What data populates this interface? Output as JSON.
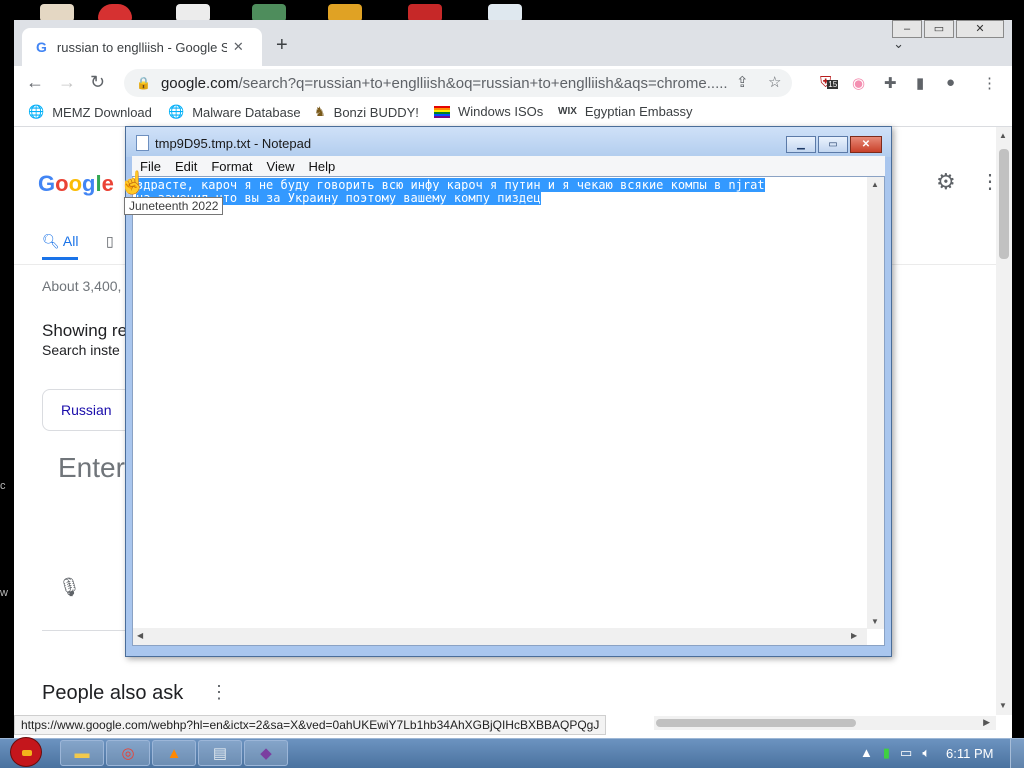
{
  "chrome": {
    "tab_title": "russian to englliish - Google Se",
    "tab_favicon": "G",
    "new_tab": "+",
    "url_host": "google.com",
    "url_path": "/search?q=russian+to+englliish&oq=russian+to+englliish&aqs=chrome.....",
    "extension_badge": "15",
    "bookmarks": [
      {
        "label": "MEMZ Download",
        "icon": "globe-icon"
      },
      {
        "label": "Malware Database",
        "icon": "globe-icon"
      },
      {
        "label": "Bonzi BUDDY!",
        "icon": "gorilla-icon"
      },
      {
        "label": "Windows ISOs",
        "icon": "rainbow-flag-icon"
      },
      {
        "label": "Egyptian Embassy",
        "icon": "wix-icon"
      }
    ],
    "status_url": "https://www.google.com/webhp?hl=en&ictx=2&sa=X&ved=0ahUKEwiY7Lb1hb34AhXGBjQIHcBXBBAQPQgJ"
  },
  "google": {
    "tab_all": "All",
    "result_stats": "About 3,400,",
    "showing": "Showing re",
    "search_instead": "Search inste",
    "translate_lang": "Russian",
    "translate_placeholder": "Enter",
    "people_also_ask": "People also ask",
    "logo_letters": [
      "G",
      "o",
      "o",
      "g",
      "l",
      "e"
    ],
    "logo_colors": [
      "#4285f4",
      "#ea4335",
      "#fbbc05",
      "#4285f4",
      "#34a853",
      "#ea4335"
    ]
  },
  "tooltip": "Juneteenth 2022",
  "notepad": {
    "title": "tmp9D95.tmp.txt - Notepad",
    "menu": [
      "File",
      "Edit",
      "Format",
      "View",
      "Help"
    ],
    "line1": "здрасте, кароч я не буду говорить всю инфу кароч я путин и я чекаю всякие компы в njrat",
    "line2": "на замечил что вы за Украину поэтому вашему компу пиздец",
    "selection_color": "#3399ff"
  },
  "taskbar": {
    "clock": "6:11 PM",
    "apps": [
      "folder-icon",
      "chrome-icon",
      "vlc-icon",
      "notepad-icon",
      "bonzi-icon"
    ]
  },
  "desktop_fragments": [
    "c",
    "w"
  ]
}
